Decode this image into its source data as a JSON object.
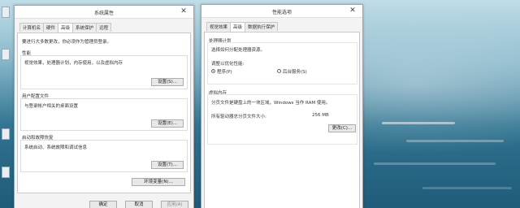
{
  "sys": {
    "title": "系统属性",
    "tabs": [
      "计算机名",
      "硬件",
      "高级",
      "系统保护",
      "远程"
    ],
    "admin_note": "要进行大多数更改，你必须作为管理员登录。",
    "perf_title": "性能",
    "perf_desc": "视觉效果，处理器计划，内存使用，以及虚拟内存",
    "perf_btn": "设置(S)...",
    "profile_title": "用户配置文件",
    "profile_desc": "与登录帐户相关的桌面设置",
    "profile_btn": "设置(E)...",
    "startup_title": "启动和故障恢复",
    "startup_desc": "系统启动、系统故障和调试信息",
    "startup_btn": "设置(T)...",
    "env_btn": "环境变量(N)...",
    "ok": "确定",
    "cancel": "取消",
    "apply": "应用(A)"
  },
  "perf": {
    "title": "性能选项",
    "tabs": [
      "视觉效果",
      "高级",
      "数据执行保护"
    ],
    "cpu_title": "处理器计划",
    "cpu_desc": "选择如何分配处理器资源。",
    "adjust_label": "调整以优化性能:",
    "opt_programs": "程序(P)",
    "opt_services": "后台服务(S)",
    "vm_title": "虚拟内存",
    "vm_desc": "分页文件是硬盘上的一块区域，Windows 当作 RAM 使用。",
    "vm_size_label": "所有驱动器总分页文件大小:",
    "vm_size_value": "256 MB",
    "change_btn": "更改(C)..."
  },
  "icons": {
    "close": "close-icon",
    "desktop_shortcut": "desktop-shortcut-icon"
  },
  "colors": {
    "window_bg": "#f3f3f3",
    "panel_bg": "#ffffff",
    "border": "#9aa5ae",
    "desktop_sea": "#3e7c97"
  }
}
